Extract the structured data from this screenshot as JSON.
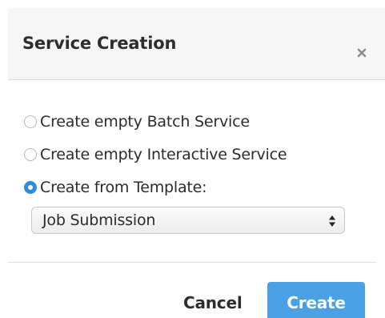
{
  "dialog": {
    "title": "Service Creation",
    "close_icon": "close-icon"
  },
  "options": [
    {
      "label": "Create empty Batch Service",
      "selected": false
    },
    {
      "label": "Create empty Interactive Service",
      "selected": false
    },
    {
      "label": "Create from Template:",
      "selected": true
    }
  ],
  "template_select": {
    "value": "Job Submission",
    "icon": "up-down-arrows-icon"
  },
  "buttons": {
    "cancel_label": "Cancel",
    "create_label": "Create"
  },
  "colors": {
    "accent": "#2d8cd9",
    "create_button": "#4aa0e2",
    "header_background": "#f6f6f6"
  }
}
